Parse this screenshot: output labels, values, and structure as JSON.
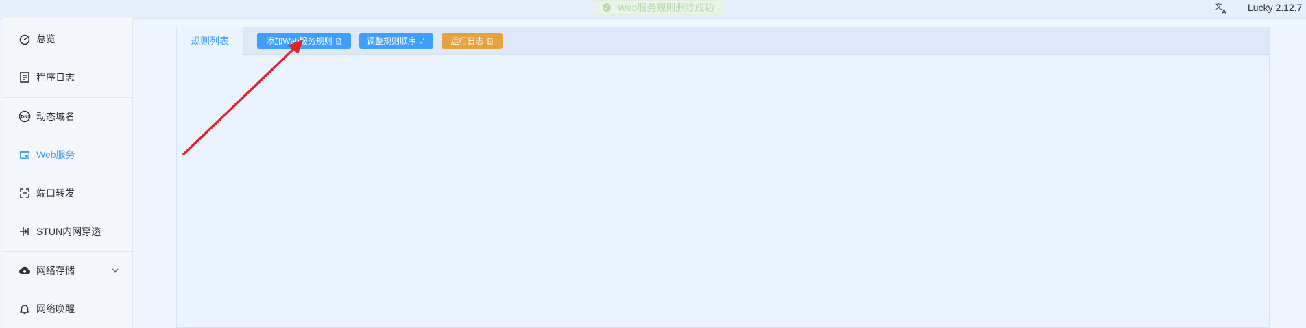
{
  "topbar": {
    "toast_text": "Web服务规则删除成功",
    "language_icon": "translate-icon",
    "version": "Lucky 2.12.7"
  },
  "sidebar": {
    "items": [
      {
        "label": "总览",
        "icon": "dashboard-icon"
      },
      {
        "label": "程序日志",
        "icon": "log-icon"
      },
      {
        "label": "动态域名",
        "icon": "dns-icon"
      },
      {
        "label": "Web服务",
        "icon": "web-service-icon",
        "active": true
      },
      {
        "label": "端口转发",
        "icon": "port-forward-icon"
      },
      {
        "label": "STUN内网穿透",
        "icon": "stun-icon"
      },
      {
        "label": "网络存储",
        "icon": "cloud-upload-icon",
        "has_submenu": true
      },
      {
        "label": "网络唤醒",
        "icon": "bell-icon"
      }
    ]
  },
  "main": {
    "tabs": [
      {
        "label": "规则列表",
        "active": true
      }
    ],
    "buttons": [
      {
        "label": "添加Web服务规则",
        "icon": "document-icon",
        "color": "#409eff"
      },
      {
        "label": "调整规则顺序",
        "icon": "swap-icon",
        "color": "#409eff"
      },
      {
        "label": "运行日志",
        "icon": "document-icon",
        "color": "#e6a23c"
      }
    ]
  },
  "colors": {
    "accent": "#409eff",
    "warning": "#e6a23c",
    "annotation": "#e02424"
  }
}
